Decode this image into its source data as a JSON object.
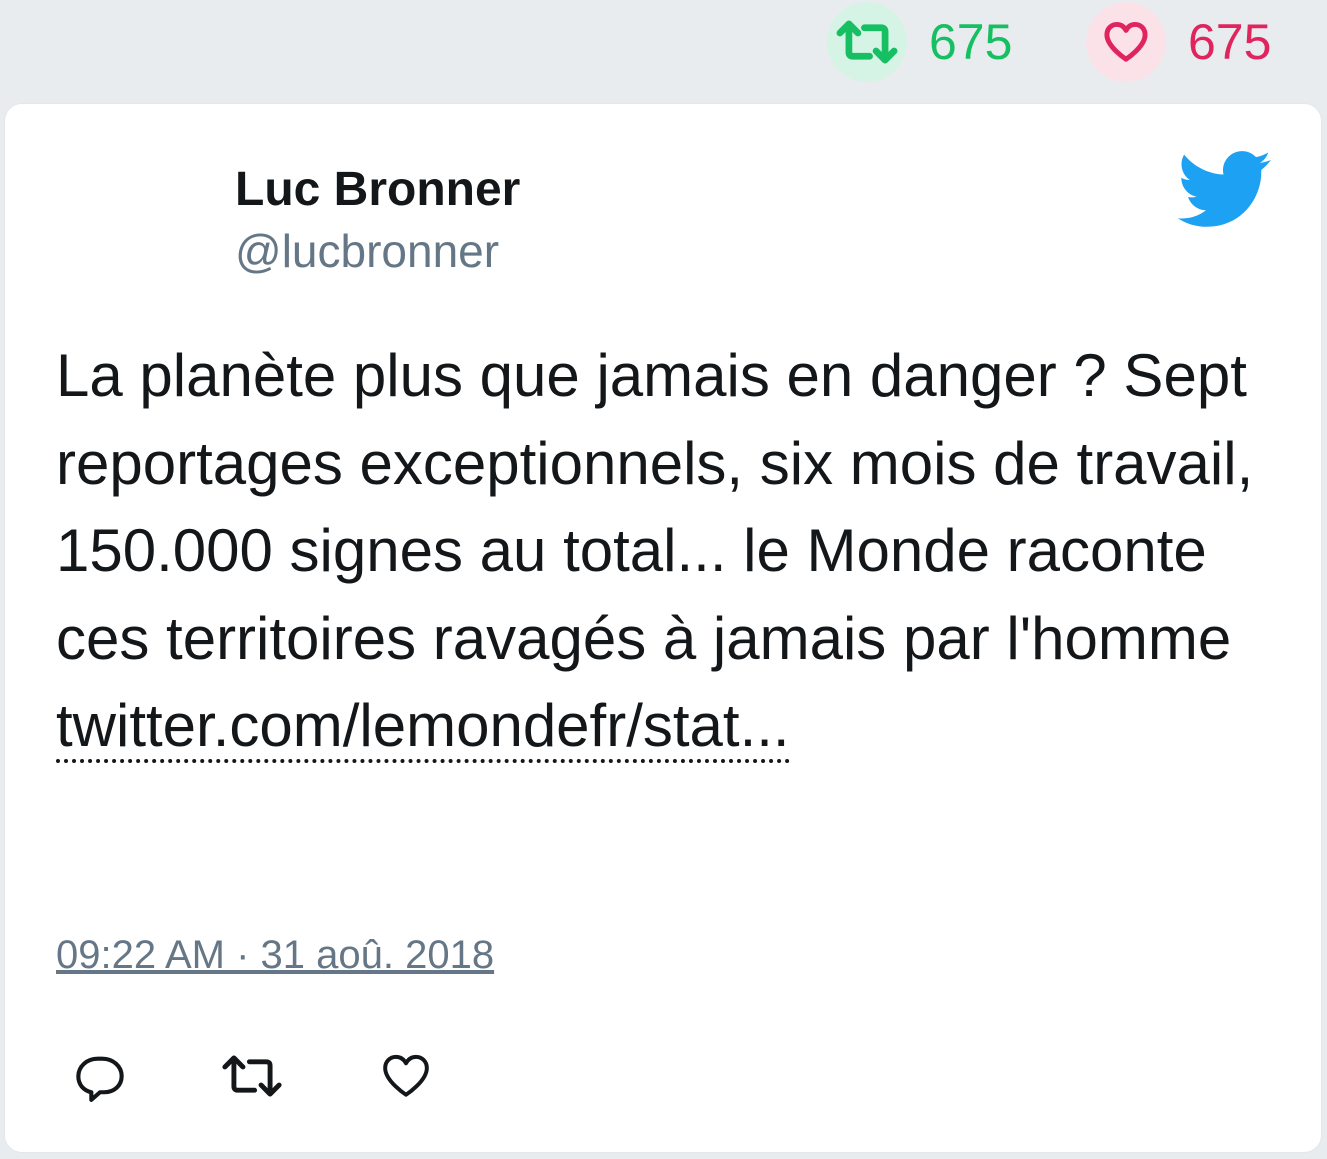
{
  "top_stats": {
    "retweet_count": "675",
    "like_count": "675",
    "retweet_icon": "retweet-icon",
    "like_icon": "heart-icon",
    "retweet_color": "#17bf63",
    "like_color": "#e0245e"
  },
  "tweet": {
    "author_name": "Luc Bronner",
    "author_handle": "@lucbronner",
    "brand_icon": "twitter-bird-icon",
    "brand_color": "#1da1f2",
    "text": "La planète plus que jamais en danger ? Sept reportages exceptionnels, six mois de travail, 150.000 signes au total... le Monde raconte ces territoires ravagés à jamais par l'homme",
    "link_text": "twitter.com/lemondefr/stat...",
    "timestamp": "09:22 AM · 31 aoû. 2018"
  },
  "actions": [
    {
      "icon": "reply-icon"
    },
    {
      "icon": "retweet-icon"
    },
    {
      "icon": "heart-icon"
    }
  ]
}
